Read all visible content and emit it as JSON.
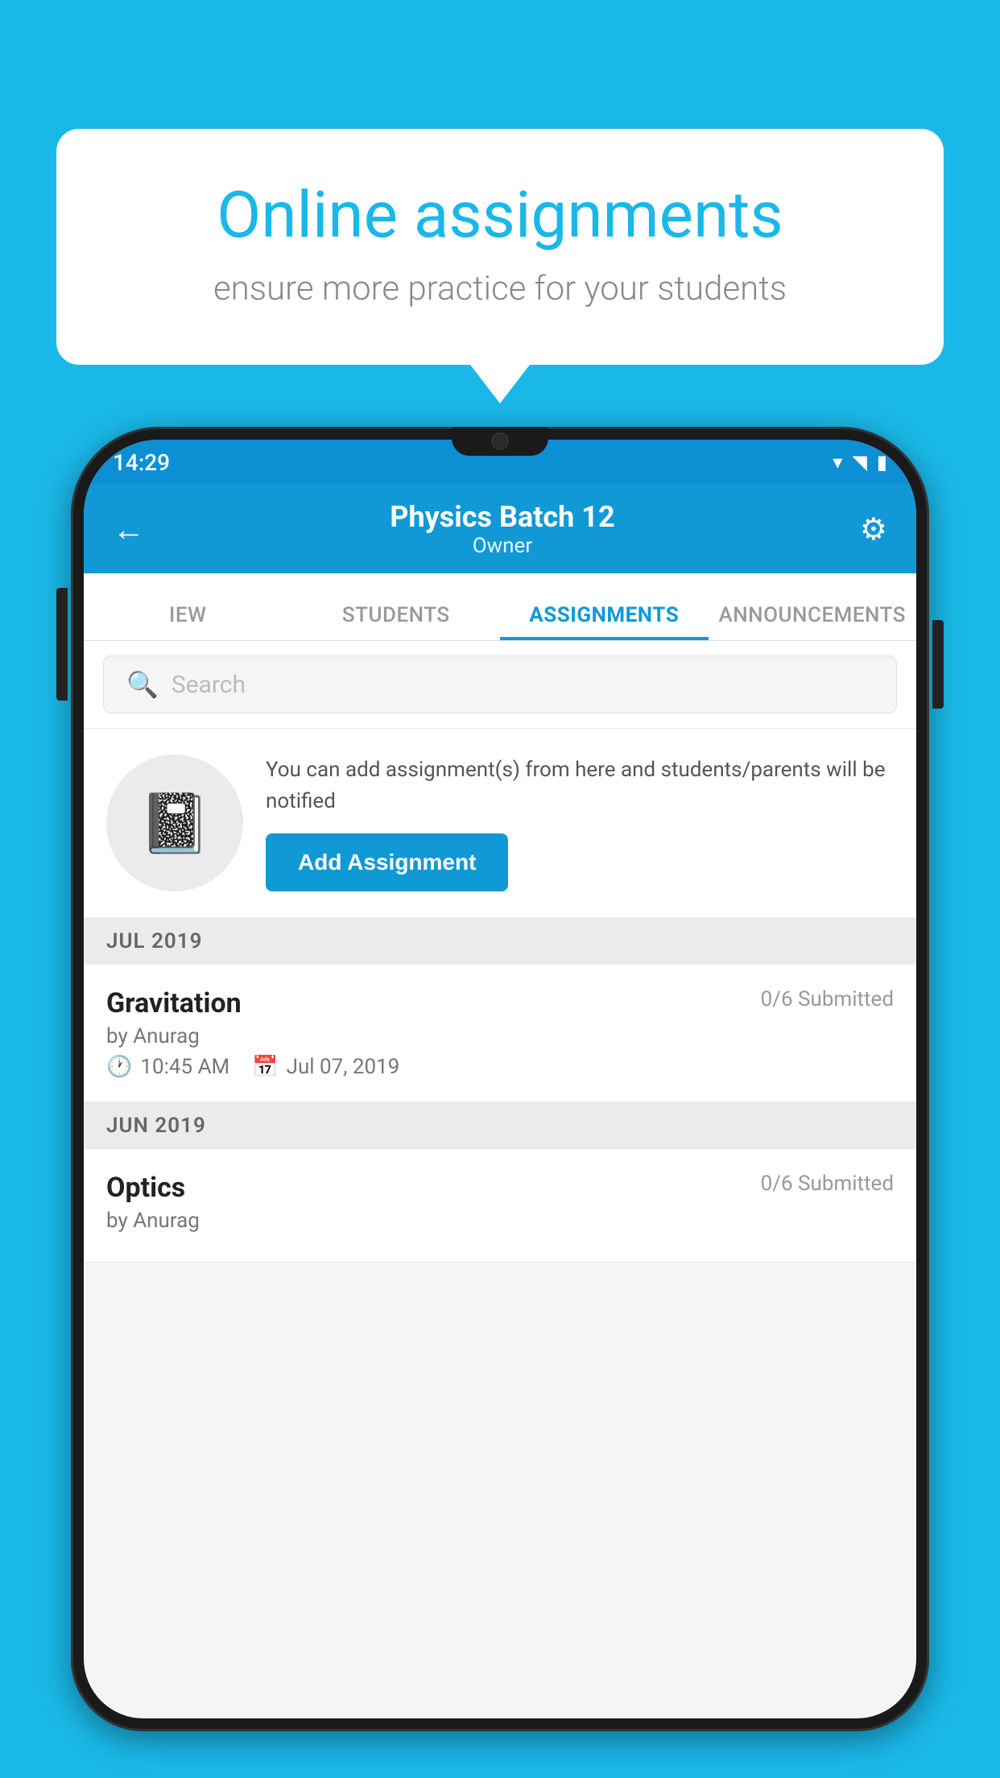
{
  "background_color": "#1ab8e8",
  "speech_bubble": {
    "title": "Online assignments",
    "subtitle": "ensure more practice for your students"
  },
  "status_bar": {
    "time": "14:29",
    "icons": [
      "wifi",
      "signal",
      "battery"
    ]
  },
  "app_header": {
    "title": "Physics Batch 12",
    "subtitle": "Owner",
    "back_label": "←",
    "settings_label": "⚙"
  },
  "tabs": [
    {
      "label": "IEW",
      "active": false
    },
    {
      "label": "STUDENTS",
      "active": false
    },
    {
      "label": "ASSIGNMENTS",
      "active": true
    },
    {
      "label": "ANNOUNCEMENTS",
      "active": false
    }
  ],
  "search": {
    "placeholder": "Search"
  },
  "promo": {
    "description": "You can add assignment(s) from here and students/parents will be notified",
    "button_label": "Add Assignment"
  },
  "assignment_sections": [
    {
      "month": "JUL 2019",
      "assignments": [
        {
          "name": "Gravitation",
          "submitted": "0/6 Submitted",
          "author": "by Anurag",
          "time": "10:45 AM",
          "date": "Jul 07, 2019"
        }
      ]
    },
    {
      "month": "JUN 2019",
      "assignments": [
        {
          "name": "Optics",
          "submitted": "0/6 Submitted",
          "author": "by Anurag",
          "time": "",
          "date": ""
        }
      ]
    }
  ]
}
